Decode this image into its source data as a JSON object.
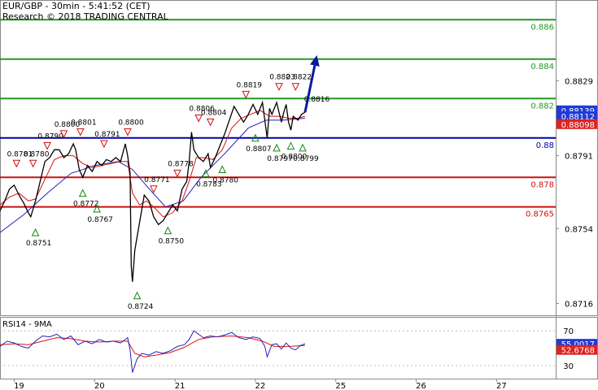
{
  "header": {
    "title": "EUR/GBP - 30min - 5:41:52 (CET)",
    "subtitle": "Research © 2018 TRADING CENTRAL"
  },
  "rsi_label": "RSI14 - 9MA",
  "colors": {
    "price": "#000000",
    "ma_fast": "#dd1111",
    "ma_slow": "#2222bb",
    "resistance": "#229922",
    "support": "#cc1111",
    "pivot": "#0000aa",
    "arrow": "#0a1a9a",
    "up_marker": "#118811",
    "down_marker": "#cc1111",
    "tag_blue": "#1f3bd6",
    "tag_red": "#dd2222"
  },
  "chart_data": {
    "type": "line",
    "price_axis": {
      "ticks": [
        "0.8829",
        "0.8791",
        "0.8754",
        "0.8716"
      ],
      "range": [
        0.871,
        0.887
      ]
    },
    "levels": [
      {
        "label": "0.886",
        "value": 0.886,
        "kind": "resistance"
      },
      {
        "label": "0.884",
        "value": 0.884,
        "kind": "resistance"
      },
      {
        "label": "0.882",
        "value": 0.882,
        "kind": "resistance"
      },
      {
        "label": "0.88",
        "value": 0.88,
        "kind": "pivot"
      },
      {
        "label": "0.878",
        "value": 0.878,
        "kind": "support"
      },
      {
        "label": "0.8765",
        "value": 0.8765,
        "kind": "support"
      }
    ],
    "current_tags": [
      {
        "label": "0.88139",
        "value": 0.8814,
        "color": "#1f3bd6"
      },
      {
        "label": "0.88112",
        "value": 0.8811,
        "color": "#1f3bd6"
      },
      {
        "label": "0.88098",
        "value": 0.8807,
        "color": "#dd2222"
      }
    ],
    "x_axis": {
      "labels": [
        "19",
        "20",
        "21",
        "22",
        "25",
        "26",
        "27"
      ],
      "positions": [
        12,
        80,
        148,
        216,
        284,
        352,
        420
      ]
    },
    "x_range": [
      0,
      470
    ],
    "close": [
      [
        0,
        0.8763
      ],
      [
        4,
        0.8768
      ],
      [
        8,
        0.8774
      ],
      [
        12,
        0.8776
      ],
      [
        16,
        0.8771
      ],
      [
        20,
        0.8767
      ],
      [
        24,
        0.8762
      ],
      [
        26,
        0.876
      ],
      [
        30,
        0.8768
      ],
      [
        34,
        0.8778
      ],
      [
        38,
        0.8788
      ],
      [
        42,
        0.879
      ],
      [
        46,
        0.8794
      ],
      [
        50,
        0.8794
      ],
      [
        54,
        0.879
      ],
      [
        58,
        0.8792
      ],
      [
        62,
        0.8797
      ],
      [
        64,
        0.8794
      ],
      [
        67,
        0.8784
      ],
      [
        70,
        0.878
      ],
      [
        74,
        0.8786
      ],
      [
        78,
        0.8783
      ],
      [
        82,
        0.8788
      ],
      [
        86,
        0.8786
      ],
      [
        90,
        0.8789
      ],
      [
        94,
        0.8788
      ],
      [
        98,
        0.879
      ],
      [
        102,
        0.8788
      ],
      [
        106,
        0.8797
      ],
      [
        108,
        0.8791
      ],
      [
        110,
        0.8782
      ],
      [
        111,
        0.8735
      ],
      [
        112,
        0.8727
      ],
      [
        114,
        0.8743
      ],
      [
        118,
        0.8757
      ],
      [
        122,
        0.8771
      ],
      [
        126,
        0.8768
      ],
      [
        130,
        0.876
      ],
      [
        134,
        0.8756
      ],
      [
        138,
        0.8758
      ],
      [
        142,
        0.8762
      ],
      [
        146,
        0.8766
      ],
      [
        150,
        0.8763
      ],
      [
        154,
        0.8774
      ],
      [
        158,
        0.8778
      ],
      [
        160,
        0.8788
      ],
      [
        162,
        0.8803
      ],
      [
        164,
        0.8794
      ],
      [
        168,
        0.879
      ],
      [
        172,
        0.8788
      ],
      [
        176,
        0.8792
      ],
      [
        178,
        0.8785
      ],
      [
        182,
        0.879
      ],
      [
        186,
        0.8796
      ],
      [
        190,
        0.8802
      ],
      [
        194,
        0.8809
      ],
      [
        198,
        0.8816
      ],
      [
        202,
        0.8812
      ],
      [
        206,
        0.8808
      ],
      [
        210,
        0.8812
      ],
      [
        214,
        0.8817
      ],
      [
        218,
        0.8812
      ],
      [
        222,
        0.8818
      ],
      [
        224,
        0.8809
      ],
      [
        226,
        0.88
      ],
      [
        228,
        0.8815
      ],
      [
        230,
        0.8812
      ],
      [
        234,
        0.8818
      ],
      [
        238,
        0.8808
      ],
      [
        240,
        0.8813
      ],
      [
        242,
        0.8817
      ],
      [
        244,
        0.8808
      ],
      [
        246,
        0.8804
      ],
      [
        248,
        0.8811
      ],
      [
        252,
        0.8809
      ],
      [
        255,
        0.8812
      ],
      [
        258,
        0.8813
      ]
    ],
    "ma_fast": [
      [
        0,
        0.8766
      ],
      [
        8,
        0.877
      ],
      [
        16,
        0.8772
      ],
      [
        24,
        0.8768
      ],
      [
        30,
        0.8769
      ],
      [
        38,
        0.8779
      ],
      [
        46,
        0.8789
      ],
      [
        54,
        0.8791
      ],
      [
        62,
        0.8791
      ],
      [
        70,
        0.8787
      ],
      [
        78,
        0.8785
      ],
      [
        86,
        0.8786
      ],
      [
        94,
        0.8787
      ],
      [
        102,
        0.8788
      ],
      [
        108,
        0.8788
      ],
      [
        112,
        0.8772
      ],
      [
        118,
        0.8766
      ],
      [
        124,
        0.8768
      ],
      [
        130,
        0.8765
      ],
      [
        138,
        0.876
      ],
      [
        146,
        0.8762
      ],
      [
        154,
        0.8768
      ],
      [
        160,
        0.8778
      ],
      [
        166,
        0.879
      ],
      [
        172,
        0.879
      ],
      [
        180,
        0.8789
      ],
      [
        188,
        0.8794
      ],
      [
        196,
        0.8805
      ],
      [
        204,
        0.881
      ],
      [
        212,
        0.8812
      ],
      [
        220,
        0.8814
      ],
      [
        228,
        0.8811
      ],
      [
        236,
        0.8811
      ],
      [
        244,
        0.881
      ],
      [
        252,
        0.881
      ],
      [
        258,
        0.8811
      ]
    ],
    "ma_slow": [
      [
        0,
        0.8752
      ],
      [
        20,
        0.8761
      ],
      [
        40,
        0.8772
      ],
      [
        60,
        0.8782
      ],
      [
        80,
        0.8786
      ],
      [
        100,
        0.8788
      ],
      [
        112,
        0.8784
      ],
      [
        125,
        0.8775
      ],
      [
        140,
        0.8765
      ],
      [
        155,
        0.8768
      ],
      [
        170,
        0.878
      ],
      [
        190,
        0.8792
      ],
      [
        210,
        0.8805
      ],
      [
        225,
        0.8809
      ],
      [
        240,
        0.8809
      ],
      [
        258,
        0.881
      ]
    ],
    "forecast_arrow": [
      [
        258,
        0.8813
      ],
      [
        268,
        0.8842
      ]
    ],
    "markers": [
      {
        "label": "0.8781",
        "x": 14,
        "price": 0.8787,
        "dir": "down"
      },
      {
        "label": "0.8780",
        "x": 28,
        "price": 0.8787,
        "dir": "down"
      },
      {
        "label": "0.8790",
        "x": 40,
        "price": 0.8796,
        "dir": "down"
      },
      {
        "label": "0.8800",
        "x": 54,
        "price": 0.8802,
        "dir": "down"
      },
      {
        "label": "0.8801",
        "x": 68,
        "price": 0.8803,
        "dir": "down"
      },
      {
        "label": "0.8791",
        "x": 88,
        "price": 0.8797,
        "dir": "down"
      },
      {
        "label": "0.8800",
        "x": 108,
        "price": 0.8803,
        "dir": "down"
      },
      {
        "label": "0.8771",
        "x": 130,
        "price": 0.8774,
        "dir": "down"
      },
      {
        "label": "0.8778",
        "x": 150,
        "price": 0.8782,
        "dir": "down"
      },
      {
        "label": "0.8806",
        "x": 168,
        "price": 0.881,
        "dir": "down"
      },
      {
        "label": "0.8804",
        "x": 178,
        "price": 0.8808,
        "dir": "down"
      },
      {
        "label": "0.8819",
        "x": 208,
        "price": 0.8822,
        "dir": "down"
      },
      {
        "label": "0.8823",
        "x": 236,
        "price": 0.8826,
        "dir": "down"
      },
      {
        "label": "0.8822",
        "x": 250,
        "price": 0.8826,
        "dir": "down"
      },
      {
        "label": "0.8751",
        "x": 30,
        "price": 0.8752,
        "dir": "up"
      },
      {
        "label": "0.8772",
        "x": 70,
        "price": 0.8772,
        "dir": "up"
      },
      {
        "label": "0.8767",
        "x": 82,
        "price": 0.8764,
        "dir": "up"
      },
      {
        "label": "0.8724",
        "x": 116,
        "price": 0.872,
        "dir": "up"
      },
      {
        "label": "0.8750",
        "x": 142,
        "price": 0.8753,
        "dir": "up"
      },
      {
        "label": "0.8783",
        "x": 174,
        "price": 0.8782,
        "dir": "up"
      },
      {
        "label": "0.8780",
        "x": 188,
        "price": 0.8784,
        "dir": "up"
      },
      {
        "label": "0.8807",
        "x": 216,
        "price": 0.88,
        "dir": "up"
      },
      {
        "label": "0.8797",
        "x": 234,
        "price": 0.8795,
        "dir": "up"
      },
      {
        "label": "0.8800",
        "x": 246,
        "price": 0.8796,
        "dir": "up"
      },
      {
        "label": "0.8799",
        "x": 256,
        "price": 0.8795,
        "dir": "up"
      }
    ],
    "other_labels": [
      {
        "label": "0.8816",
        "x": 268,
        "price": 0.8816
      }
    ],
    "rsi": {
      "label": "RSI14 - 9MA",
      "ticks": [
        "70",
        "30"
      ],
      "range": [
        15,
        85
      ],
      "values": [
        [
          0,
          52
        ],
        [
          6,
          58
        ],
        [
          12,
          56
        ],
        [
          18,
          52
        ],
        [
          24,
          50
        ],
        [
          30,
          58
        ],
        [
          36,
          64
        ],
        [
          42,
          63
        ],
        [
          48,
          66
        ],
        [
          54,
          60
        ],
        [
          60,
          64
        ],
        [
          66,
          54
        ],
        [
          72,
          58
        ],
        [
          78,
          55
        ],
        [
          84,
          60
        ],
        [
          90,
          57
        ],
        [
          96,
          58
        ],
        [
          102,
          56
        ],
        [
          108,
          62
        ],
        [
          110,
          48
        ],
        [
          112,
          22
        ],
        [
          116,
          38
        ],
        [
          120,
          44
        ],
        [
          126,
          42
        ],
        [
          132,
          46
        ],
        [
          138,
          44
        ],
        [
          144,
          47
        ],
        [
          150,
          52
        ],
        [
          156,
          54
        ],
        [
          160,
          60
        ],
        [
          164,
          70
        ],
        [
          168,
          66
        ],
        [
          172,
          62
        ],
        [
          178,
          64
        ],
        [
          184,
          63
        ],
        [
          190,
          65
        ],
        [
          196,
          68
        ],
        [
          202,
          62
        ],
        [
          208,
          60
        ],
        [
          214,
          63
        ],
        [
          220,
          61
        ],
        [
          224,
          52
        ],
        [
          226,
          40
        ],
        [
          230,
          54
        ],
        [
          234,
          55
        ],
        [
          238,
          49
        ],
        [
          242,
          56
        ],
        [
          246,
          50
        ],
        [
          250,
          48
        ],
        [
          254,
          53
        ],
        [
          258,
          55
        ]
      ],
      "ma": [
        [
          0,
          54
        ],
        [
          12,
          55
        ],
        [
          24,
          54
        ],
        [
          36,
          58
        ],
        [
          48,
          62
        ],
        [
          60,
          61
        ],
        [
          72,
          58
        ],
        [
          84,
          57
        ],
        [
          96,
          58
        ],
        [
          108,
          58
        ],
        [
          114,
          44
        ],
        [
          122,
          40
        ],
        [
          132,
          42
        ],
        [
          144,
          45
        ],
        [
          156,
          51
        ],
        [
          168,
          60
        ],
        [
          180,
          63
        ],
        [
          196,
          64
        ],
        [
          210,
          62
        ],
        [
          222,
          58
        ],
        [
          232,
          52
        ],
        [
          244,
          52
        ],
        [
          258,
          53
        ]
      ],
      "tags": [
        {
          "label": "55.0017",
          "value": 55.0,
          "color": "#1f3bd6"
        },
        {
          "label": "52.6768",
          "value": 48.0,
          "color": "#dd2222"
        }
      ]
    }
  }
}
